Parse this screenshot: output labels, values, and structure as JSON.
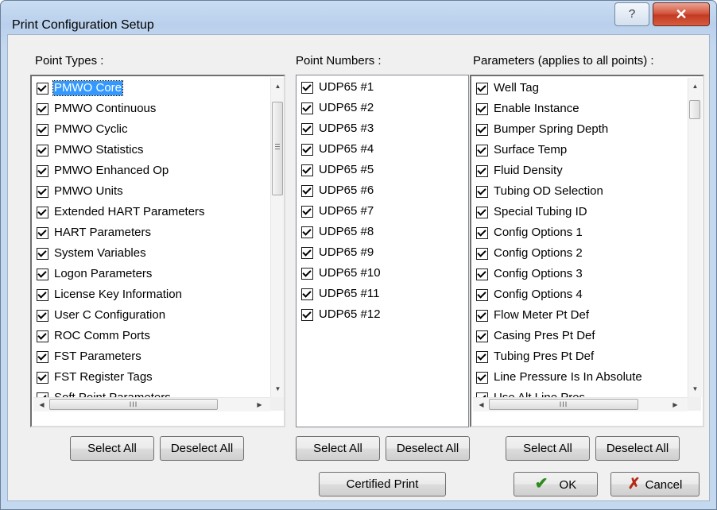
{
  "window": {
    "title": "Print Configuration Setup",
    "help_label": "?",
    "close_label": "✕"
  },
  "point_types": {
    "label": "Point Types :",
    "items": [
      "PMWO Core",
      "PMWO Continuous",
      "PMWO Cyclic",
      "PMWO Statistics",
      "PMWO Enhanced Op",
      "PMWO Units",
      "Extended HART Parameters",
      "HART Parameters",
      "System Variables",
      "Logon Parameters",
      "License Key Information",
      "User C Configuration",
      "ROC Comm Ports",
      "FST Parameters",
      "FST Register Tags",
      "Soft Point Parameters"
    ],
    "selected_item": "PMWO Core",
    "select_all_label": "Select All",
    "deselect_all_label": "Deselect All"
  },
  "point_numbers": {
    "label": "Point Numbers :",
    "items": [
      "UDP65 #1",
      "UDP65 #2",
      "UDP65 #3",
      "UDP65 #4",
      "UDP65 #5",
      "UDP65 #6",
      "UDP65 #7",
      "UDP65 #8",
      "UDP65 #9",
      "UDP65 #10",
      "UDP65 #11",
      "UDP65 #12"
    ],
    "select_all_label": "Select All",
    "deselect_all_label": "Deselect All"
  },
  "parameters": {
    "label": "Parameters (applies to all points) :",
    "items": [
      "Well Tag",
      "Enable Instance",
      "Bumper Spring Depth",
      "Surface Temp",
      "Fluid Density",
      "Tubing OD Selection",
      "Special Tubing ID",
      "Config Options 1",
      "Config Options 2",
      "Config Options 3",
      "Config Options 4",
      "Flow Meter Pt Def",
      "Casing Pres Pt Def",
      "Tubing Pres Pt Def",
      "Line Pressure Is In Absolute",
      "Use Alt Line Pres"
    ],
    "select_all_label": "Select All",
    "deselect_all_label": "Deselect All"
  },
  "footer": {
    "certified_print_label": "Certified Print",
    "ok_label": "OK",
    "cancel_label": "Cancel"
  },
  "icons": {
    "checkbox": "checkbox-checked-icon",
    "ok": "checkmark-icon",
    "cancel": "x-icon"
  },
  "colors": {
    "selection": "#3399ff",
    "ok_check": "#2e8b1e",
    "cancel_x": "#b52a16",
    "close_button": "#c23a22"
  }
}
